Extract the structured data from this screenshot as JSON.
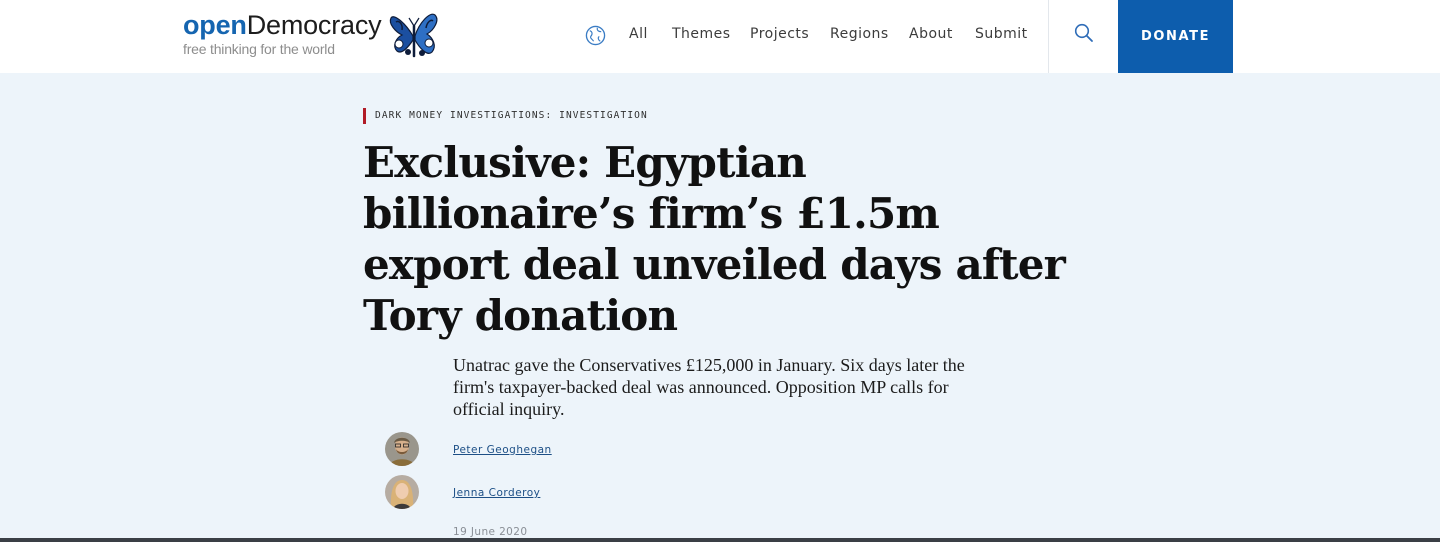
{
  "header": {
    "logo": {
      "brand_open": "open",
      "brand_democracy": "Democracy",
      "tagline": "free thinking for the world",
      "icon": "butterfly-logo"
    },
    "nav": {
      "globe_icon": "globe-icon",
      "items": [
        {
          "label": "All"
        },
        {
          "label": "Themes"
        },
        {
          "label": "Projects"
        },
        {
          "label": "Regions"
        },
        {
          "label": "About"
        },
        {
          "label": "Submit"
        }
      ],
      "search_icon": "search-icon"
    },
    "donate_label": "DONATE"
  },
  "article": {
    "kicker": "DARK MONEY INVESTIGATIONS: INVESTIGATION",
    "headline": "Exclusive: Egyptian billionaire’s firm’s £1.5m export deal unveiled days after Tory donation",
    "standfirst": "Unatrac gave the Conservatives £125,000 in January. Six days later the firm's taxpayer-backed deal was announced. Opposition MP calls for official inquiry.",
    "authors": [
      {
        "name": "Peter Geoghegan"
      },
      {
        "name": "Jenna Corderoy"
      }
    ],
    "date": "19 June 2020"
  },
  "colors": {
    "page_background": "#edf4fa",
    "brand_blue": "#1565b0",
    "donate_background": "#0d5dad",
    "kicker_accent": "#b11b26",
    "link": "#1d4f86"
  }
}
